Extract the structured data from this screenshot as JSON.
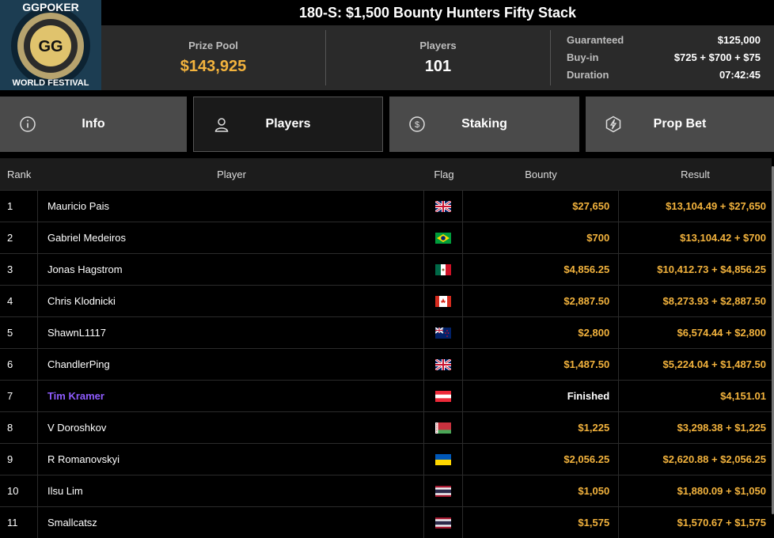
{
  "logo": {
    "top_text": "GGPOKER",
    "bottom_text": "WORLD FESTIVAL",
    "center_text": "GG"
  },
  "tournament": {
    "title": "180-S: $1,500 Bounty Hunters Fifty Stack"
  },
  "stats": {
    "prize_pool_label": "Prize Pool",
    "prize_pool_value": "$143,925",
    "players_label": "Players",
    "players_value": "101",
    "guaranteed_label": "Guaranteed",
    "guaranteed_value": "$125,000",
    "buyin_label": "Buy-in",
    "buyin_value": "$725 + $700 + $75",
    "duration_label": "Duration",
    "duration_value": "07:42:45"
  },
  "tabs": [
    {
      "label": "Info",
      "icon": "info-icon"
    },
    {
      "label": "Players",
      "icon": "user-icon",
      "active": true
    },
    {
      "label": "Staking",
      "icon": "dollar-coin-icon"
    },
    {
      "label": "Prop Bet",
      "icon": "lightning-hexagon-icon"
    }
  ],
  "table": {
    "headers": {
      "rank": "Rank",
      "player": "Player",
      "flag": "Flag",
      "bounty": "Bounty",
      "result": "Result"
    },
    "rows": [
      {
        "rank": "1",
        "player": "Mauricio Pais",
        "flag": "uk",
        "bounty": "$27,650",
        "result": "$13,104.49 + $27,650"
      },
      {
        "rank": "2",
        "player": "Gabriel Medeiros",
        "flag": "brazil",
        "bounty": "$700",
        "result": "$13,104.42 + $700"
      },
      {
        "rank": "3",
        "player": "Jonas Hagstrom",
        "flag": "mexico",
        "bounty": "$4,856.25",
        "result": "$10,412.73 + $4,856.25"
      },
      {
        "rank": "4",
        "player": "Chris Klodnicki",
        "flag": "canada",
        "bounty": "$2,887.50",
        "result": "$8,273.93 + $2,887.50"
      },
      {
        "rank": "5",
        "player": "ShawnL1117",
        "flag": "new-zealand",
        "bounty": "$2,800",
        "result": "$6,574.44 + $2,800"
      },
      {
        "rank": "6",
        "player": "ChandlerPing",
        "flag": "uk",
        "bounty": "$1,487.50",
        "result": "$5,224.04 + $1,487.50"
      },
      {
        "rank": "7",
        "player": "Tim Kramer",
        "flag": "austria",
        "bounty": "Finished",
        "result": "$4,151.01",
        "highlight": true
      },
      {
        "rank": "8",
        "player": "V Doroshkov",
        "flag": "belarus",
        "bounty": "$1,225",
        "result": "$3,298.38 + $1,225"
      },
      {
        "rank": "9",
        "player": "R Romanovskyi",
        "flag": "ukraine",
        "bounty": "$2,056.25",
        "result": "$2,620.88 + $2,056.25"
      },
      {
        "rank": "10",
        "player": "Ilsu Lim",
        "flag": "thailand",
        "bounty": "$1,050",
        "result": "$1,880.09 + $1,050"
      },
      {
        "rank": "11",
        "player": "Smallcatsz",
        "flag": "thailand",
        "bounty": "$1,575",
        "result": "$1,570.67 + $1,575"
      }
    ]
  },
  "colors": {
    "gold": "#f3b33d",
    "highlight_player": "#8f5cff",
    "active_tab": "#1a1a1a",
    "inactive_tab": "#4a4a4a"
  }
}
